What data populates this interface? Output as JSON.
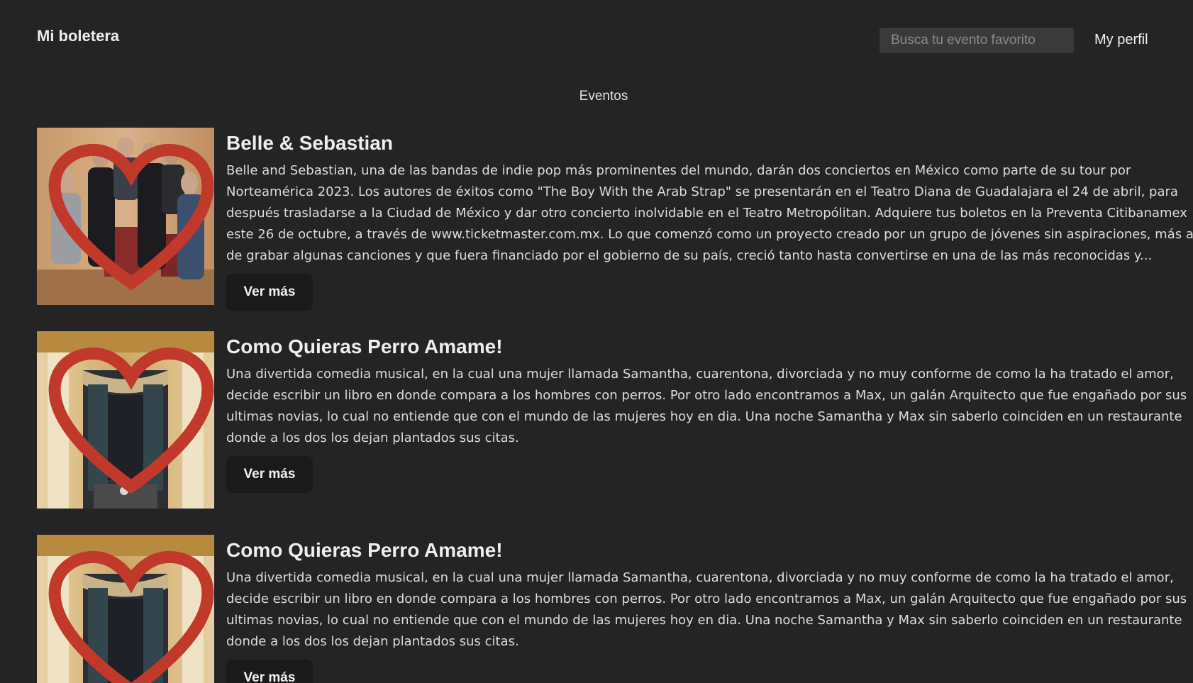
{
  "header": {
    "brand": "Mi boletera",
    "search_placeholder": "Busca tu evento favorito",
    "profile_label": "My perfil"
  },
  "section_title": "Eventos",
  "events": [
    {
      "title": "Belle & Sebastian",
      "description": "Belle and Sebastian, una de las bandas de indie pop más prominentes del mundo, darán dos conciertos en México como parte de su tour por Norteamérica 2023. Los autores de éxitos como \"The Boy With the Arab Strap\" se presentarán en el Teatro Diana de Guadalajara el 24 de abril, para después trasladarse a la Ciudad de México y dar otro concierto inolvidable en el Teatro Metropólitan. Adquiere tus boletos en la Preventa Citibanamex este 26 de octubre, a través de www.ticketmaster.com.mx. Lo que comenzó como un proyecto creado por un grupo de jóvenes sin aspiraciones, más allá de grabar algunas canciones y que fuera financiado por el gobierno de su país, creció tanto hasta convertirse en una de las más reconocidas y...",
      "button_label": "Ver más",
      "image": "band-photo",
      "favorite_icon": "heart-outline-icon"
    },
    {
      "title": "Como Quieras Perro Amame!",
      "description": "Una divertida comedia musical, en la cual una mujer llamada Samantha, cuarentona, divorciada y no muy conforme de como la ha tratado el amor, decide escribir un libro en donde compara a los hombres con perros. Por otro lado encontramos a Max, un galán Arquitecto que fue engañado por sus ultimas novias, lo cual no entiende que con el mundo de las mujeres hoy en dia. Una noche Samantha y Max sin saberlo coinciden en un restaurante donde a los dos los dejan plantados sus citas.",
      "button_label": "Ver más",
      "image": "theater-stage-photo",
      "favorite_icon": "heart-outline-icon"
    },
    {
      "title": "Como Quieras Perro Amame!",
      "description": "Una divertida comedia musical, en la cual una mujer llamada Samantha, cuarentona, divorciada y no muy conforme de como la ha tratado el amor, decide escribir un libro en donde compara a los hombres con perros. Por otro lado encontramos a Max, un galán Arquitecto que fue engañado por sus ultimas novias, lo cual no entiende que con el mundo de las mujeres hoy en dia. Una noche Samantha y Max sin saberlo coinciden en un restaurante donde a los dos los dejan plantados sus citas.",
      "button_label": "Ver más",
      "image": "theater-stage-photo",
      "favorite_icon": "heart-outline-icon"
    }
  ],
  "colors": {
    "background": "#242424",
    "button_bg": "#1a1a1a",
    "search_bg": "#3a3a3a",
    "heart_outline": "#c0392b"
  }
}
